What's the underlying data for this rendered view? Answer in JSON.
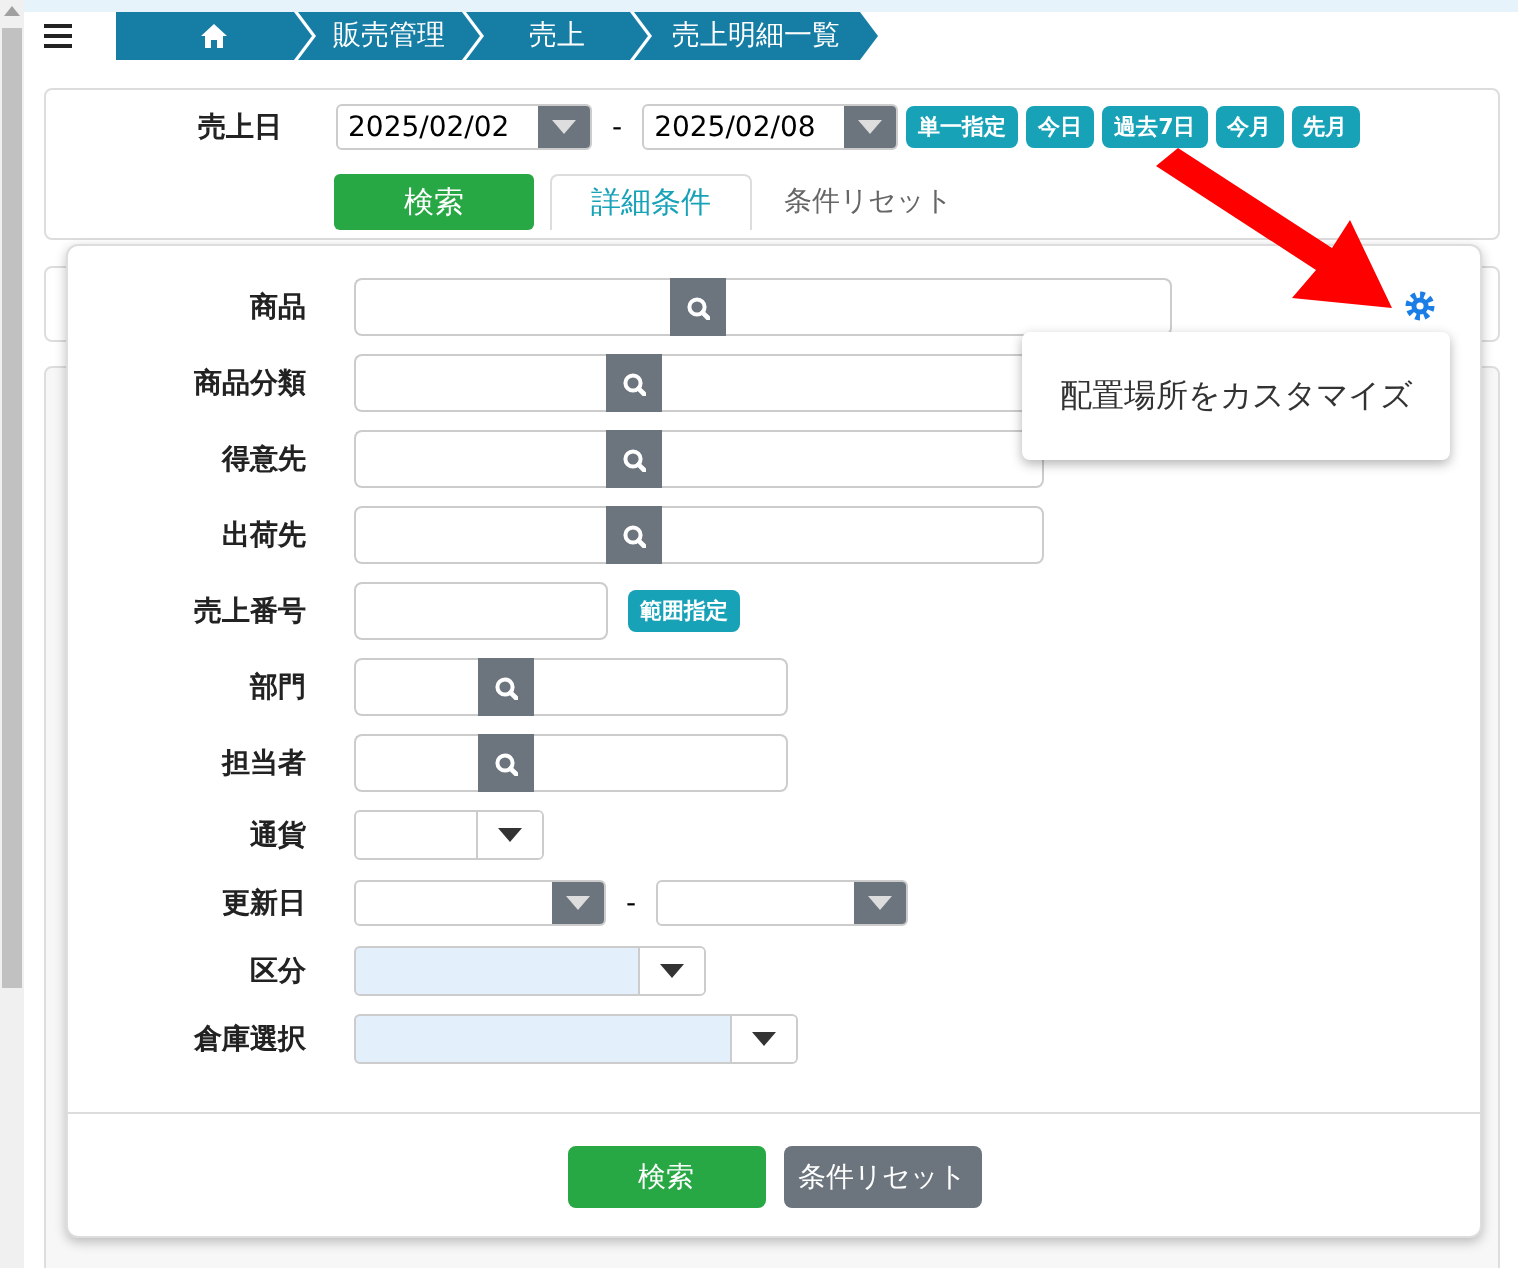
{
  "breadcrumb": [
    {
      "kind": "home"
    },
    {
      "kind": "text",
      "label": "販売管理"
    },
    {
      "kind": "text",
      "label": "売上"
    },
    {
      "kind": "text",
      "label": "売上明細一覧"
    }
  ],
  "date_filter": {
    "label": "売上日",
    "from": "2025/02/02",
    "separator": "-",
    "to": "2025/02/08",
    "quick_buttons": [
      "単一指定",
      "今日",
      "過去7日",
      "今月",
      "先月"
    ]
  },
  "actions": {
    "search": "検索",
    "detail_tab": {
      "label": "詳細条件",
      "selected": true
    },
    "reset": "条件リセット"
  },
  "detail_panel": {
    "fields": [
      {
        "label": "商品",
        "kind": "lookup"
      },
      {
        "label": "商品分類",
        "kind": "lookup"
      },
      {
        "label": "得意先",
        "kind": "lookup"
      },
      {
        "label": "出荷先",
        "kind": "lookup"
      },
      {
        "label": "売上番号",
        "kind": "text",
        "badge": "範囲指定"
      },
      {
        "label": "部門",
        "kind": "lookup"
      },
      {
        "label": "担当者",
        "kind": "lookup"
      },
      {
        "label": "通貨",
        "kind": "select",
        "highlighted": false
      },
      {
        "label": "更新日",
        "kind": "daterange",
        "separator": "-"
      },
      {
        "label": "区分",
        "kind": "select",
        "highlighted": true
      },
      {
        "label": "倉庫選択",
        "kind": "select",
        "highlighted": true
      }
    ],
    "buttons": [
      {
        "label": "検索",
        "kind": "primary"
      },
      {
        "label": "条件リセット",
        "kind": "secondary"
      }
    ]
  },
  "tooltip": {
    "text": "配置場所をカスタマイズ"
  },
  "annotation": {
    "kind": "arrow"
  }
}
